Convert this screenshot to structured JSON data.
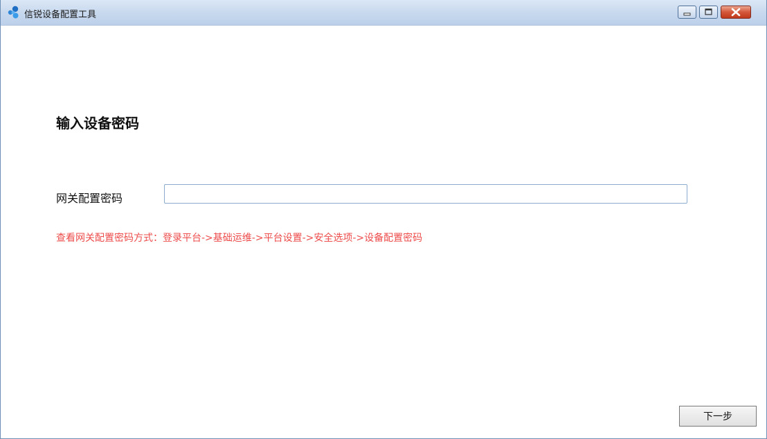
{
  "window": {
    "title": "信锐设备配置工具",
    "icons": {
      "app": "app-logo-icon",
      "minimize": "minimize-icon",
      "maximize": "maximize-icon",
      "close": "close-icon"
    }
  },
  "main": {
    "heading": "输入设备密码",
    "password_field": {
      "label": "网关配置密码",
      "value": "",
      "placeholder": ""
    },
    "hint": "查看网关配置密码方式：登录平台->基础运维->平台设置->安全选项->设备配置密码",
    "next_button": "下一步"
  },
  "colors": {
    "hint": "#ee4b4b",
    "titlebar": "#c8d9ee",
    "close_button": "#c0391c"
  }
}
